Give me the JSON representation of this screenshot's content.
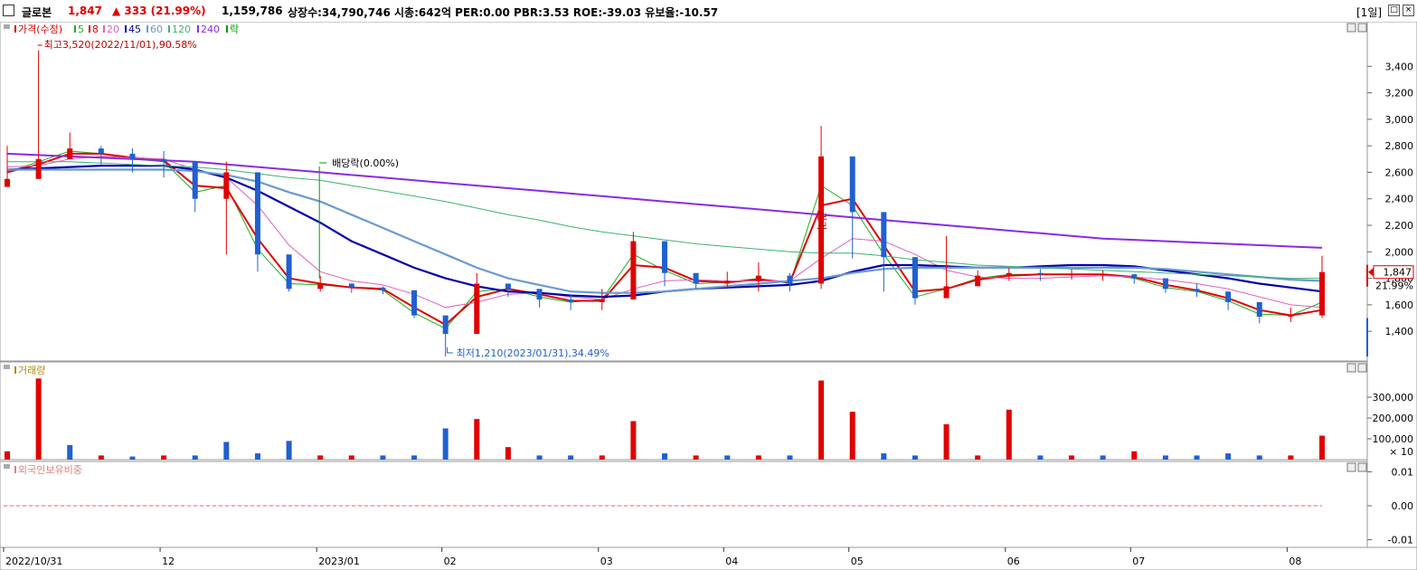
{
  "header": {
    "stock_name": "글로본",
    "price": "1,847",
    "change": "▲ 333 (21.99%)",
    "volume": "1,159,786",
    "stats": "상장수:34,790,746 시총:642억 PER:0.00 PBR:3.53 ROE:-39.03 유보율:-10.57",
    "period": "[1일]",
    "up_color": "#e00000"
  },
  "chart_data": [
    {
      "type": "candlestick",
      "title": "",
      "legend": [
        {
          "label": "가격(수정)",
          "color": "#d00000"
        },
        {
          "label": "5",
          "color": "#22aa22"
        },
        {
          "label": "8",
          "color": "#e00000"
        },
        {
          "label": "20",
          "color": "#e060c0"
        },
        {
          "label": "45",
          "color": "#0000aa"
        },
        {
          "label": "60",
          "color": "#6a9ad0"
        },
        {
          "label": "120",
          "color": "#3cb371"
        },
        {
          "label": "240",
          "color": "#8a2be2"
        },
        {
          "label": "락",
          "color": "#009900"
        }
      ],
      "x_ticks": [
        "2022/10/31",
        "12",
        "2023/01",
        "02",
        "03",
        "04",
        "05",
        "06",
        "07",
        "08"
      ],
      "ylim": [
        1210,
        3600
      ],
      "y_ticks": [
        1400,
        1600,
        1800,
        2000,
        2200,
        2400,
        2600,
        2800,
        3000,
        3200,
        3400
      ],
      "y_tick_labels": [
        "1,400",
        "1,600",
        "1,800",
        "2,000",
        "2,200",
        "2,400",
        "2,600",
        "2,800",
        "3,000",
        "3,200",
        "3,400"
      ],
      "annotations": {
        "high": "최고3,520(2022/11/01),90.58%",
        "low": "최저1,210(2023/01/31),34.49%",
        "dividend": "배당락(0.00%)",
        "event": "권리"
      },
      "last_price_label": "1,847",
      "last_change_label": "21.99%",
      "x": [
        "2022/10/31",
        "2022/11/01",
        "2022/11/07",
        "2022/11/14",
        "2022/11/21",
        "2022/11/28",
        "2022/12/05",
        "2022/12/12",
        "2022/12/19",
        "2022/12/26",
        "2023/01/02",
        "2023/01/09",
        "2023/01/16",
        "2023/01/23",
        "2023/01/31",
        "2023/02/06",
        "2023/02/13",
        "2023/02/20",
        "2023/02/27",
        "2023/03/06",
        "2023/03/13",
        "2023/03/20",
        "2023/03/27",
        "2023/04/03",
        "2023/04/10",
        "2023/04/17",
        "2023/04/24",
        "2023/05/01",
        "2023/05/08",
        "2023/05/15",
        "2023/05/22",
        "2023/05/30",
        "2023/06/05",
        "2023/06/12",
        "2023/06/19",
        "2023/06/26",
        "2023/07/03",
        "2023/07/10",
        "2023/07/17",
        "2023/07/24",
        "2023/07/31",
        "2023/08/07",
        "2023/08/14"
      ],
      "series": [
        {
          "name": "가격(수정)",
          "kind": "close",
          "values": [
            2550,
            2700,
            2780,
            2740,
            2700,
            2680,
            2400,
            2600,
            1980,
            1720,
            1760,
            1730,
            1710,
            1520,
            1380,
            1760,
            1720,
            1640,
            1620,
            1640,
            2080,
            1840,
            1760,
            1780,
            1820,
            1760,
            2720,
            2300,
            1960,
            1650,
            1740,
            1820,
            1840,
            1830,
            1830,
            1830,
            1800,
            1720,
            1700,
            1620,
            1510,
            1520,
            1847
          ],
          "high": [
            2800,
            3520,
            2900,
            2800,
            2780,
            2760,
            2600,
            2680,
            2100,
            1800,
            1820,
            1760,
            1740,
            1560,
            1490,
            1840,
            1760,
            1700,
            1680,
            1720,
            2150,
            1920,
            1820,
            1850,
            1920,
            1840,
            2950,
            2480,
            2040,
            1730,
            2120,
            1860,
            1880,
            1870,
            1870,
            1860,
            1830,
            1780,
            1760,
            1670,
            1580,
            1580,
            1970
          ],
          "low": [
            2500,
            2580,
            2700,
            2660,
            2600,
            2560,
            2300,
            1980,
            1850,
            1700,
            1700,
            1690,
            1680,
            1500,
            1210,
            1700,
            1660,
            1580,
            1560,
            1560,
            1640,
            1740,
            1720,
            1720,
            1700,
            1700,
            1720,
            1950,
            1700,
            1600,
            1680,
            1760,
            1780,
            1780,
            1790,
            1780,
            1760,
            1690,
            1660,
            1560,
            1460,
            1470,
            1500
          ]
        },
        {
          "name": "5",
          "kind": "ma",
          "values": [
            2600,
            2680,
            2760,
            2740,
            2700,
            2680,
            2450,
            2500,
            2020,
            1760,
            1750,
            1730,
            1710,
            1540,
            1420,
            1700,
            1720,
            1660,
            1620,
            1640,
            1980,
            1860,
            1760,
            1770,
            1800,
            1760,
            2500,
            2350,
            1980,
            1660,
            1720,
            1800,
            1830,
            1830,
            1830,
            1830,
            1800,
            1730,
            1700,
            1630,
            1530,
            1520,
            1620
          ]
        },
        {
          "name": "8",
          "kind": "ma",
          "values": [
            2600,
            2660,
            2740,
            2740,
            2710,
            2690,
            2500,
            2480,
            2100,
            1800,
            1760,
            1730,
            1720,
            1580,
            1450,
            1660,
            1720,
            1680,
            1630,
            1630,
            1900,
            1880,
            1780,
            1770,
            1790,
            1770,
            2350,
            2400,
            2050,
            1700,
            1720,
            1790,
            1820,
            1830,
            1830,
            1830,
            1810,
            1750,
            1710,
            1650,
            1560,
            1520,
            1560
          ]
        },
        {
          "name": "20",
          "kind": "ma",
          "values": [
            2640,
            2650,
            2700,
            2720,
            2710,
            2700,
            2620,
            2560,
            2350,
            2050,
            1850,
            1780,
            1750,
            1680,
            1580,
            1620,
            1680,
            1690,
            1660,
            1640,
            1720,
            1780,
            1790,
            1780,
            1780,
            1780,
            1950,
            2100,
            2080,
            1980,
            1860,
            1810,
            1800,
            1800,
            1810,
            1820,
            1810,
            1790,
            1760,
            1720,
            1660,
            1600,
            1580
          ]
        },
        {
          "name": "45",
          "kind": "ma",
          "values": [
            2620,
            2630,
            2640,
            2650,
            2650,
            2650,
            2620,
            2560,
            2460,
            2340,
            2220,
            2080,
            1980,
            1880,
            1800,
            1740,
            1700,
            1690,
            1670,
            1660,
            1670,
            1700,
            1720,
            1730,
            1740,
            1750,
            1780,
            1850,
            1900,
            1900,
            1890,
            1880,
            1880,
            1890,
            1900,
            1900,
            1890,
            1860,
            1830,
            1800,
            1760,
            1730,
            1700
          ]
        },
        {
          "name": "60",
          "kind": "ma",
          "values": [
            2620,
            2620,
            2620,
            2620,
            2620,
            2620,
            2610,
            2580,
            2530,
            2450,
            2380,
            2280,
            2180,
            2080,
            1980,
            1880,
            1800,
            1750,
            1700,
            1690,
            1690,
            1700,
            1720,
            1740,
            1760,
            1780,
            1800,
            1840,
            1870,
            1880,
            1880,
            1880,
            1880,
            1880,
            1880,
            1880,
            1880,
            1870,
            1850,
            1830,
            1810,
            1790,
            1780
          ]
        },
        {
          "name": "120",
          "kind": "ma",
          "values": [
            2680,
            2680,
            2680,
            2670,
            2660,
            2650,
            2640,
            2620,
            2590,
            2560,
            2540,
            2500,
            2460,
            2420,
            2380,
            2330,
            2280,
            2240,
            2190,
            2150,
            2120,
            2090,
            2060,
            2040,
            2020,
            2000,
            1990,
            1990,
            1970,
            1940,
            1920,
            1900,
            1890,
            1880,
            1870,
            1860,
            1850,
            1840,
            1830,
            1820,
            1810,
            1800,
            1800
          ]
        },
        {
          "name": "240",
          "kind": "ma",
          "values": [
            2740,
            2730,
            2720,
            2710,
            2700,
            2690,
            2680,
            2660,
            2640,
            2620,
            2600,
            2580,
            2560,
            2540,
            2520,
            2500,
            2480,
            2460,
            2440,
            2420,
            2400,
            2380,
            2360,
            2340,
            2320,
            2300,
            2280,
            2260,
            2240,
            2220,
            2200,
            2180,
            2160,
            2140,
            2120,
            2100,
            2090,
            2080,
            2070,
            2060,
            2050,
            2040,
            2030
          ]
        }
      ]
    },
    {
      "type": "bar",
      "title": "",
      "legend": [
        {
          "label": "거래량",
          "color": "#b8860b"
        }
      ],
      "y_tick_labels": [
        "300,000",
        "200,000",
        "100,000",
        "× 10"
      ],
      "y_ticks": [
        300000,
        200000,
        100000
      ],
      "ylim": [
        0,
        400000
      ],
      "x": [
        "2022/10/31",
        "2022/11/01",
        "2022/11/07",
        "2022/11/14",
        "2022/11/21",
        "2022/11/28",
        "2022/12/05",
        "2022/12/12",
        "2022/12/19",
        "2022/12/26",
        "2023/01/02",
        "2023/01/09",
        "2023/01/16",
        "2023/01/23",
        "2023/01/31",
        "2023/02/06",
        "2023/02/13",
        "2023/02/20",
        "2023/02/27",
        "2023/03/06",
        "2023/03/13",
        "2023/03/20",
        "2023/03/27",
        "2023/04/03",
        "2023/04/10",
        "2023/04/17",
        "2023/04/24",
        "2023/05/01",
        "2023/05/08",
        "2023/05/15",
        "2023/05/22",
        "2023/05/30",
        "2023/06/05",
        "2023/06/12",
        "2023/06/19",
        "2023/06/26",
        "2023/07/03",
        "2023/07/10",
        "2023/07/17",
        "2023/07/24",
        "2023/07/31",
        "2023/08/07",
        "2023/08/14"
      ],
      "values": [
        40000,
        390000,
        70000,
        20000,
        15000,
        20000,
        20000,
        85000,
        30000,
        90000,
        20000,
        20000,
        20000,
        20000,
        150000,
        195000,
        60000,
        20000,
        20000,
        20000,
        185000,
        30000,
        20000,
        20000,
        20000,
        20000,
        380000,
        230000,
        30000,
        20000,
        170000,
        20000,
        240000,
        20000,
        20000,
        20000,
        40000,
        20000,
        20000,
        30000,
        20000,
        20000,
        115000
      ],
      "up": [
        true,
        true,
        false,
        true,
        false,
        true,
        false,
        false,
        false,
        false,
        true,
        true,
        false,
        false,
        false,
        true,
        true,
        false,
        false,
        true,
        true,
        false,
        true,
        false,
        true,
        false,
        true,
        true,
        false,
        false,
        true,
        true,
        true,
        false,
        true,
        false,
        true,
        false,
        false,
        false,
        false,
        true,
        true
      ]
    },
    {
      "type": "line",
      "title": "",
      "legend": [
        {
          "label": "외국인보유비중",
          "color": "#e08080"
        }
      ],
      "y_ticks": [
        0.01,
        0.0,
        -0.01
      ],
      "y_tick_labels": [
        "0.01",
        "0.00",
        "-0.01"
      ],
      "ylim": [
        -0.012,
        0.012
      ],
      "values": [
        0.0,
        0.0
      ]
    }
  ]
}
